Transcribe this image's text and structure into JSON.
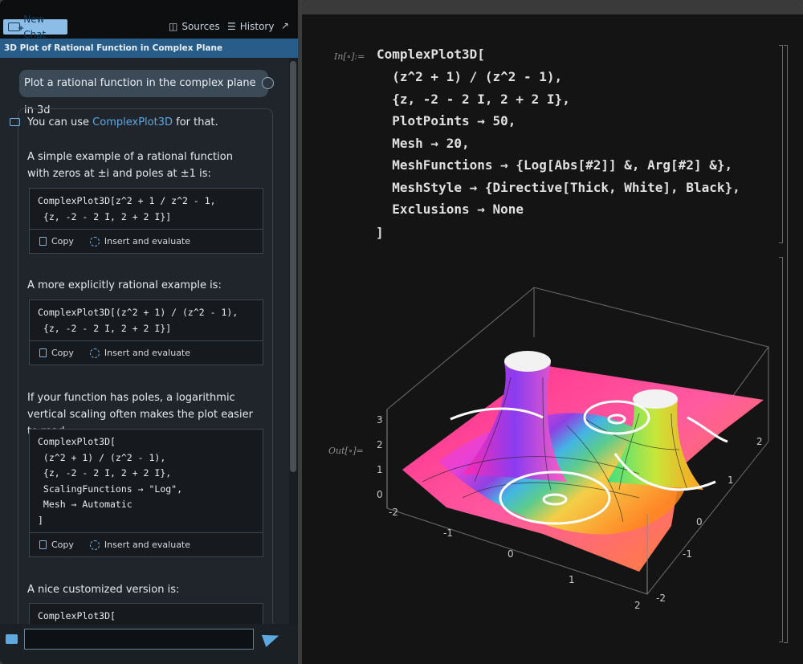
{
  "toolbar": {
    "new_chat": "New Chat",
    "sources": "Sources",
    "history": "History"
  },
  "chat_title": "3D Plot of Rational Function in Complex Plane",
  "user_message": "Plot a rational function in the complex plane in 3d",
  "assistant": {
    "intro_prefix": "You can use ",
    "intro_link": "ComplexPlot3D",
    "intro_suffix": " for that.",
    "para1": "A simple example of a rational function with zeros at ±i and poles at ±1 is:",
    "code1_line1": "ComplexPlot3D[z^2 + 1 / z^2 - 1,",
    "code1_line2": " {z, -2 - 2 I, 2 + 2 I}]",
    "para2": "A more explicitly rational example is:",
    "code2_line1": "ComplexPlot3D[(z^2 + 1) / (z^2 - 1),",
    "code2_line2": " {z, -2 - 2 I, 2 + 2 I}]",
    "para3": "If your function has poles, a logarithmic vertical scaling  often makes the plot easier to read:",
    "code3_lines": [
      "ComplexPlot3D[",
      " (z^2 + 1) / (z^2 - 1),",
      " {z, -2 - 2 I, 2 + 2 I},",
      " ScalingFunctions → \"Log\",",
      " Mesh → Automatic",
      "]"
    ],
    "para4": "A nice customized version is:",
    "code4_line1": "ComplexPlot3D[",
    "copy_label": "Copy",
    "insert_label": "Insert and evaluate"
  },
  "notebook": {
    "in_label": "In[∘]:=",
    "out_label": "Out[∘]=",
    "code_lines": [
      "ComplexPlot3D[",
      "  (z^2 + 1) / (z^2 - 1),",
      "  {z, -2 - 2 I, 2 + 2 I},",
      "  PlotPoints → 50,",
      "  Mesh → 20,",
      "  MeshFunctions → {Log[Abs[#2]] &, Arg[#2] &},",
      "  MeshStyle → {Directive[Thick, White], Black},",
      "  Exclusions → None",
      "]"
    ]
  },
  "plot": {
    "z_ticks": [
      "0",
      "1",
      "2",
      "3"
    ],
    "left_ticks": [
      "-2",
      "-1",
      "0",
      "1",
      "2"
    ],
    "right_ticks": [
      "2",
      "1",
      "0",
      "-1",
      "-2"
    ]
  }
}
